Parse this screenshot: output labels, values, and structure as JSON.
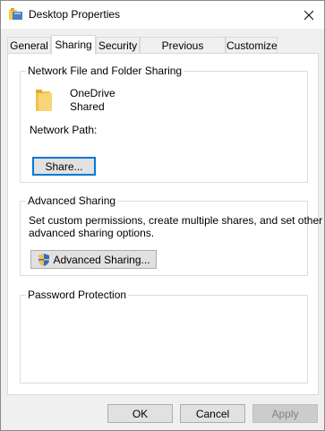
{
  "window": {
    "title": "Desktop Properties"
  },
  "tabs": [
    {
      "label": "General"
    },
    {
      "label": "Sharing"
    },
    {
      "label": "Security"
    },
    {
      "label": "Previous Versions"
    },
    {
      "label": "Customize"
    }
  ],
  "network_sharing": {
    "group_label": "Network File and Folder Sharing",
    "item_name": "OneDrive",
    "item_status": "Shared",
    "network_path_label": "Network Path:",
    "share_button": "Share..."
  },
  "advanced_sharing": {
    "group_label": "Advanced Sharing",
    "description_line1": "Set custom permissions, create multiple shares, and set other",
    "description_line2": "advanced sharing options.",
    "button": "Advanced Sharing..."
  },
  "password_protection": {
    "group_label": "Password Protection"
  },
  "footer": {
    "ok": "OK",
    "cancel": "Cancel",
    "apply": "Apply"
  },
  "icons": {
    "title": "folder-icon",
    "close": "close-icon",
    "shared_folder": "folder-icon",
    "uac": "uac-shield-icon"
  }
}
